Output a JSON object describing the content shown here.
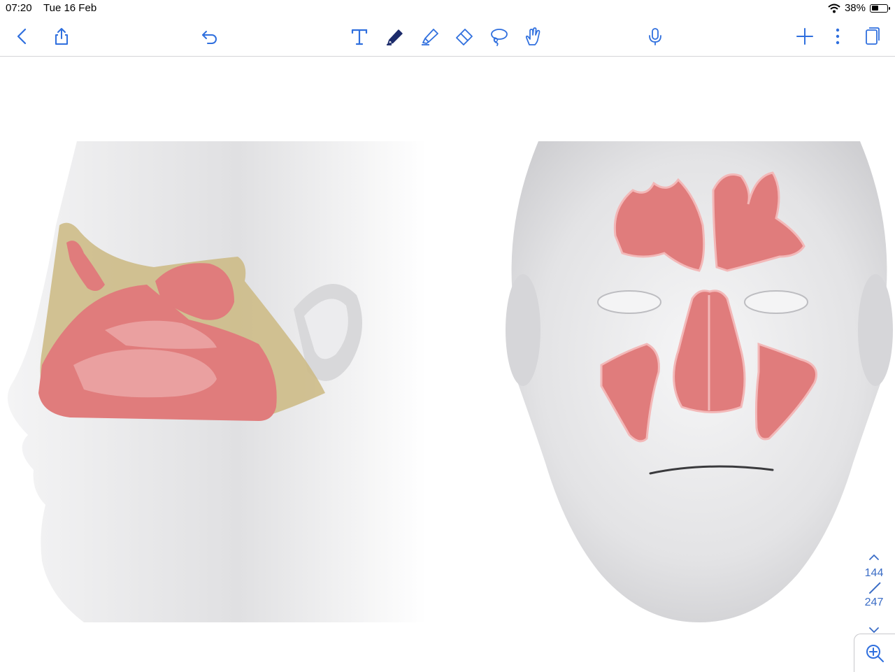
{
  "status": {
    "time": "07:20",
    "date": "Tue 16 Feb",
    "battery": "38%",
    "battery_level": 0.38
  },
  "toolbar": {
    "left": [
      {
        "name": "back-chevron-icon"
      },
      {
        "name": "share-icon"
      },
      {
        "name": "undo-icon"
      }
    ],
    "tools": [
      {
        "name": "text-tool-icon"
      },
      {
        "name": "pen-tool-icon",
        "selected": true
      },
      {
        "name": "highlighter-tool-icon"
      },
      {
        "name": "eraser-tool-icon"
      },
      {
        "name": "lasso-tool-icon"
      },
      {
        "name": "hand-gesture-icon"
      }
    ],
    "right": [
      {
        "name": "microphone-icon"
      },
      {
        "name": "add-icon"
      },
      {
        "name": "more-vertical-icon"
      },
      {
        "name": "pages-icon"
      }
    ],
    "accent_color": "#2f6fde"
  },
  "pager": {
    "current": "144",
    "total": "247"
  },
  "illustration": {
    "skin_color": "#e2e2e4",
    "mucosa_color": "#e07c7c",
    "bone_color": "#cdbb87"
  }
}
